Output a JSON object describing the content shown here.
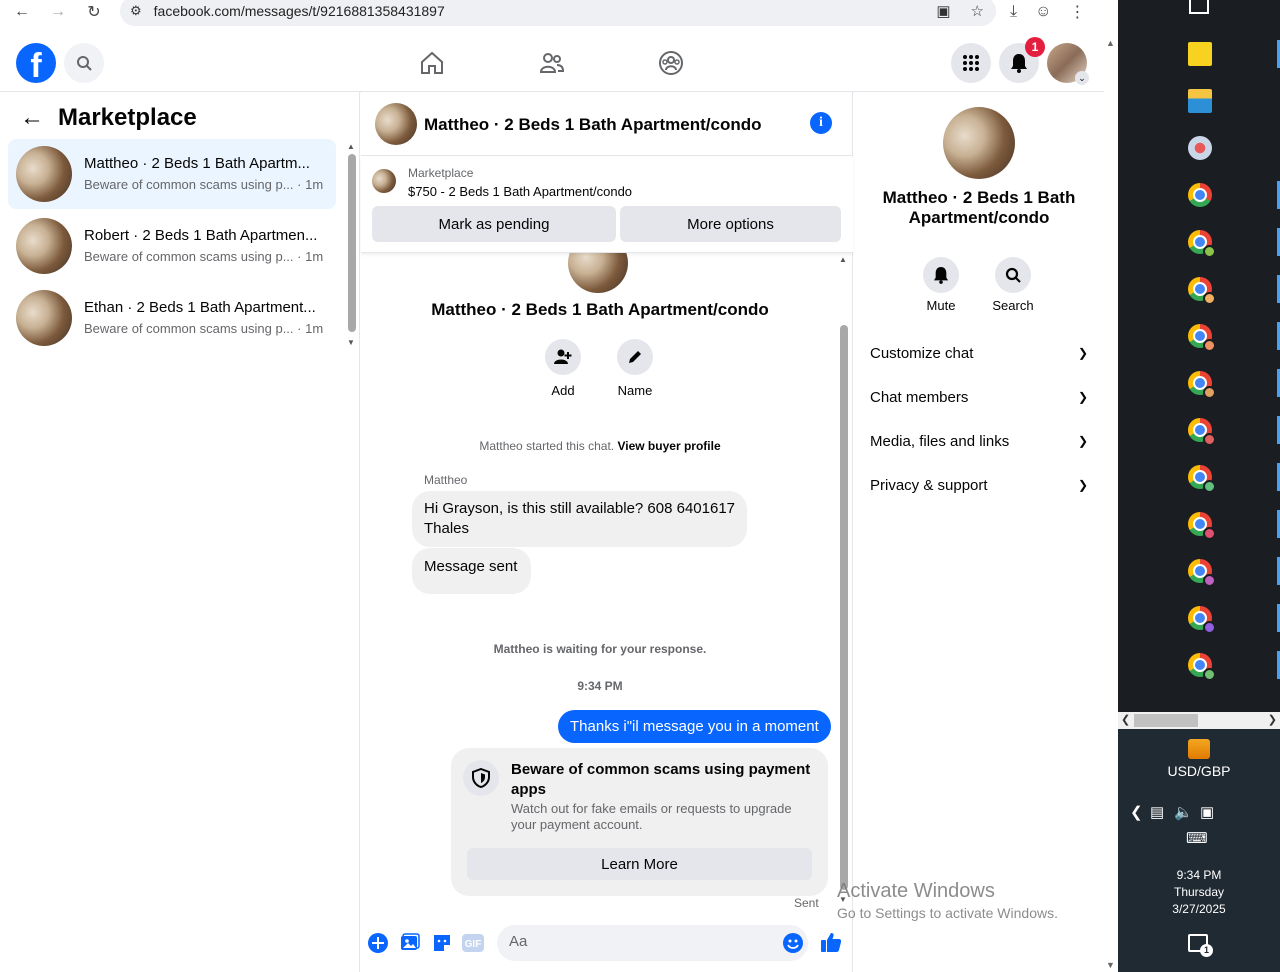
{
  "browser": {
    "url": "facebook.com/messages/t/9216881358431897"
  },
  "fb_header": {
    "logo_letter": "f",
    "notification_count": "1"
  },
  "left_panel": {
    "title": "Marketplace",
    "conversations": [
      {
        "name": "Mattheo · 2 Beds 1 Bath Apartm...",
        "preview": "Beware of common scams using p...",
        "time": "· 1m",
        "active": true
      },
      {
        "name": "Robert · 2 Beds 1 Bath Apartmen...",
        "preview": "Beware of common scams using p...",
        "time": "· 1m",
        "active": false
      },
      {
        "name": "Ethan · 2 Beds 1 Bath Apartment...",
        "preview": "Beware of common scams using p...",
        "time": "· 1m",
        "active": false
      }
    ]
  },
  "chat": {
    "header_title": "Mattheo · 2 Beds 1 Bath Apartment/condo",
    "marketplace_label": "Marketplace",
    "listing": "$750 - 2 Beds 1 Bath Apartment/condo",
    "mark_pending": "Mark as pending",
    "more_options": "More options",
    "profile_title": "Mattheo · 2 Beds 1 Bath Apartment/condo",
    "add_label": "Add",
    "name_label": "Name",
    "started_text": "Mattheo started this chat.",
    "view_buyer": "View buyer profile",
    "sender": "Mattheo",
    "incoming_message": "Hi Grayson, is this still available? 608 6401617 Thales",
    "message_sent": "Message sent",
    "waiting_text": "Mattheo is waiting for your response.",
    "timestamp": "9:34 PM",
    "outgoing_message": "Thanks i\"il message you in a moment",
    "scam_title": "Beware of common scams using payment apps",
    "scam_body": "Watch out for fake emails or requests to upgrade your payment account.",
    "learn_more": "Learn More",
    "sent_status": "Sent",
    "composer_placeholder": "Aa"
  },
  "right_panel": {
    "title": "Mattheo · 2 Beds 1 Bath Apartment/condo",
    "mute_label": "Mute",
    "search_label": "Search",
    "sections": [
      "Customize chat",
      "Chat members",
      "Media, files and links",
      "Privacy & support"
    ]
  },
  "watermark": {
    "line1": "Activate Windows",
    "line2": "Go to Settings to activate Windows."
  },
  "taskbar": {
    "currency_label": "USD/GBP",
    "time": "9:34 PM",
    "day": "Thursday",
    "date": "3/27/2025",
    "notification_count": "1"
  },
  "colors": {
    "fb_blue": "#0866ff",
    "active_conv_bg": "#ebf5ff",
    "bubble_gray": "#f0f0f0",
    "taskbar_bg": "#1a1d22"
  }
}
